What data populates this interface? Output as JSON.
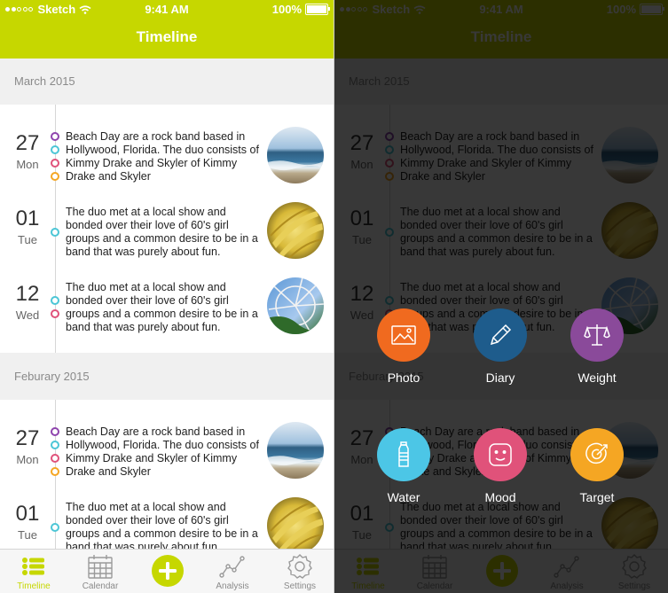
{
  "status": {
    "carrier": "Sketch",
    "time": "9:41 AM",
    "battery": "100%"
  },
  "nav": {
    "title": "Timeline"
  },
  "sections": [
    {
      "header": "March 2015",
      "entries": [
        {
          "day": "27",
          "weekday": "Mon",
          "text": "Beach Day are a rock band based in Hollywood, Florida. The duo consists of Kimmy Drake and Skyler of Kimmy Drake and Skyler",
          "markers": [
            "#8e44ad",
            "#4cc6d6",
            "#e0527a",
            "#f5a623"
          ],
          "photo": "beach"
        },
        {
          "day": "01",
          "weekday": "Tue",
          "text": "The duo met at a local show and bonded over their love of 60's girl groups and a common desire to be in a band that was purely about fun.",
          "markers": [
            "#4cc6d6"
          ],
          "photo": "bananas"
        },
        {
          "day": "12",
          "weekday": "Wed",
          "text": "The duo met at a local show and bonded over their love of 60's girl groups and a common desire to be in a band that was purely about fun.",
          "markers": [
            "#4cc6d6",
            "#e0527a"
          ],
          "photo": "ride"
        }
      ]
    },
    {
      "header": "Feburary 2015",
      "entries": [
        {
          "day": "27",
          "weekday": "Mon",
          "text": "Beach Day are a rock band based in Hollywood, Florida. The duo consists of Kimmy Drake and Skyler of Kimmy Drake and Skyler",
          "markers": [
            "#8e44ad",
            "#4cc6d6",
            "#e0527a",
            "#f5a623"
          ],
          "photo": "beach"
        },
        {
          "day": "01",
          "weekday": "Tue",
          "text": "The duo met at a local show and bonded over their love of 60's girl groups and a common desire to be in a band that was purely about fun.",
          "markers": [
            "#4cc6d6"
          ],
          "photo": "bananas"
        }
      ]
    }
  ],
  "tabs": [
    {
      "label": "Timeline",
      "icon": "list-icon",
      "active": true
    },
    {
      "label": "Calendar",
      "icon": "calendar-icon",
      "active": false
    },
    {
      "label": "",
      "icon": "plus-icon",
      "active": false
    },
    {
      "label": "Analysis",
      "icon": "analysis-icon",
      "active": false
    },
    {
      "label": "Settings",
      "icon": "gear-icon",
      "active": false
    }
  ],
  "actions": [
    {
      "label": "Photo",
      "icon": "photo-icon",
      "color": "#f06a1f"
    },
    {
      "label": "Diary",
      "icon": "pencil-icon",
      "color": "#1e5c8c"
    },
    {
      "label": "Weight",
      "icon": "scale-icon",
      "color": "#8a4a9a"
    },
    {
      "label": "Water",
      "icon": "bottle-icon",
      "color": "#4cc6e6"
    },
    {
      "label": "Mood",
      "icon": "smiley-icon",
      "color": "#e0527a"
    },
    {
      "label": "Target",
      "icon": "target-icon",
      "color": "#f5a623"
    }
  ],
  "colors": {
    "accent": "#c6d700",
    "overlay": "rgba(0,0,0,0.78)"
  }
}
